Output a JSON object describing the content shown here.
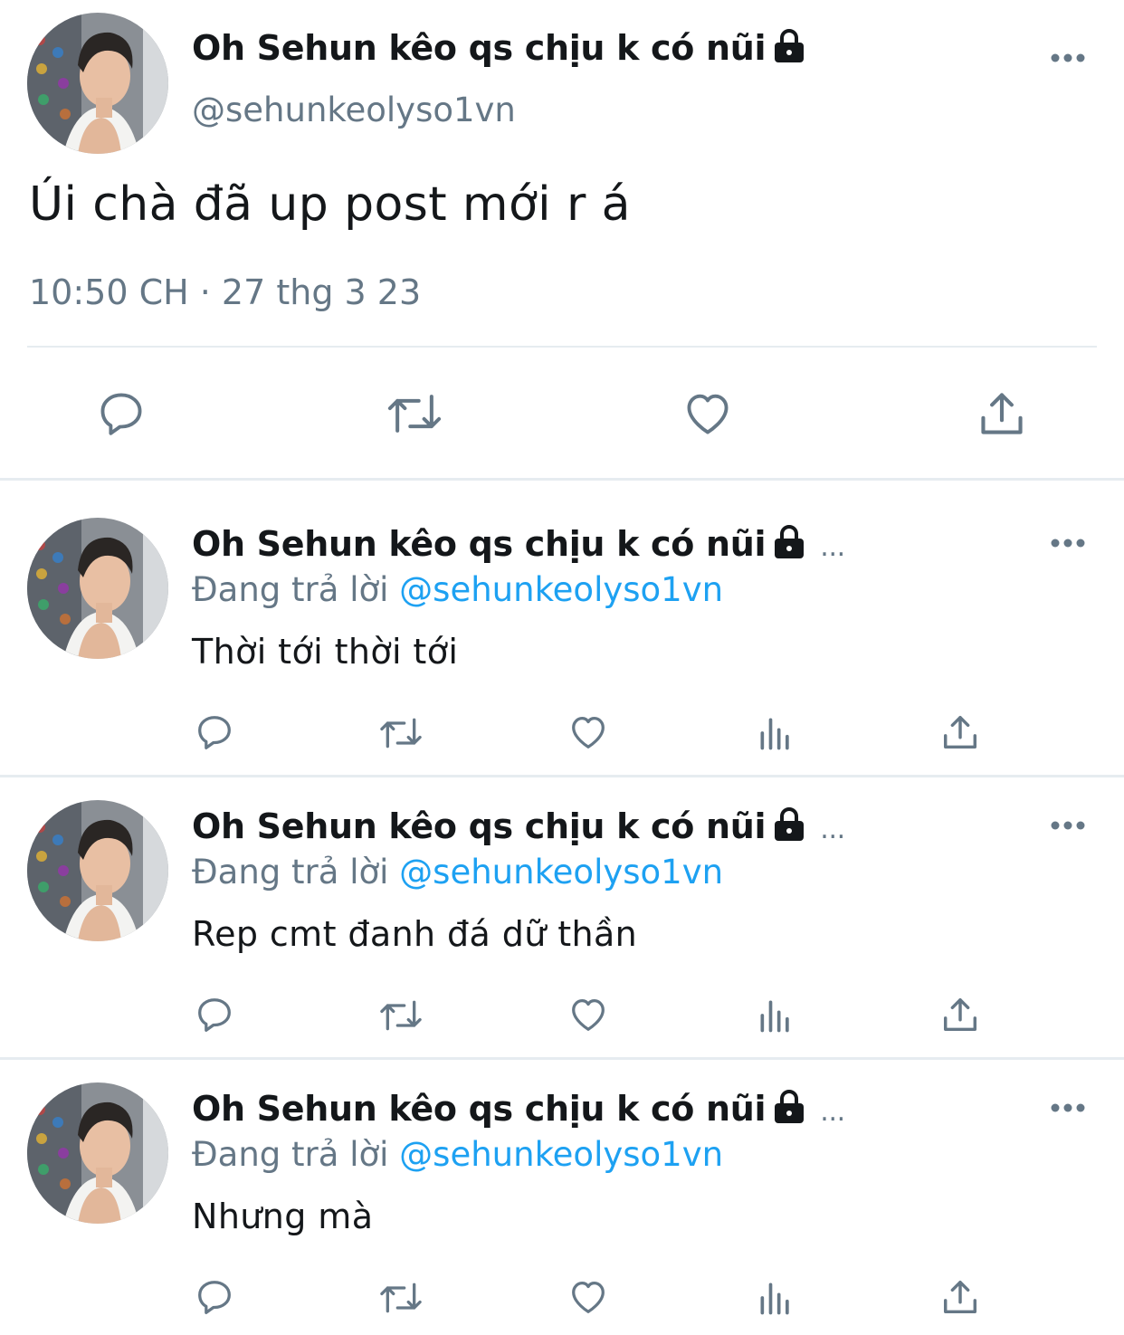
{
  "main_tweet": {
    "display_name": "Oh Sehun kêo qs chịu k có nũi",
    "handle": "@sehunkeolyso1vn",
    "text": "Úi chà đã up post mới r á",
    "timestamp": "10:50 CH · 27 thg 3 23",
    "actions": [
      "reply-icon",
      "retweet-icon",
      "like-icon",
      "share-icon"
    ]
  },
  "replies": [
    {
      "display_name": "Oh Sehun kêo qs chịu k có nũi",
      "ellipsis": "...",
      "replying_prefix": "Đang trả lời",
      "replying_to": "@sehunkeolyso1vn",
      "text": "Thời tới thời tới"
    },
    {
      "display_name": "Oh Sehun kêo qs chịu k có nũi",
      "ellipsis": "...",
      "replying_prefix": "Đang trả lời",
      "replying_to": "@sehunkeolyso1vn",
      "text": "Rep cmt đanh đá dữ thần"
    },
    {
      "display_name": "Oh Sehun kêo qs chịu k có nũi",
      "ellipsis": "...",
      "replying_prefix": "Đang trả lời",
      "replying_to": "@sehunkeolyso1vn",
      "text": "Nhưng mà"
    }
  ],
  "colors": {
    "text": "#14171a",
    "secondary": "#657786",
    "link": "#1da1f2",
    "divider": "#e6ecf0"
  }
}
